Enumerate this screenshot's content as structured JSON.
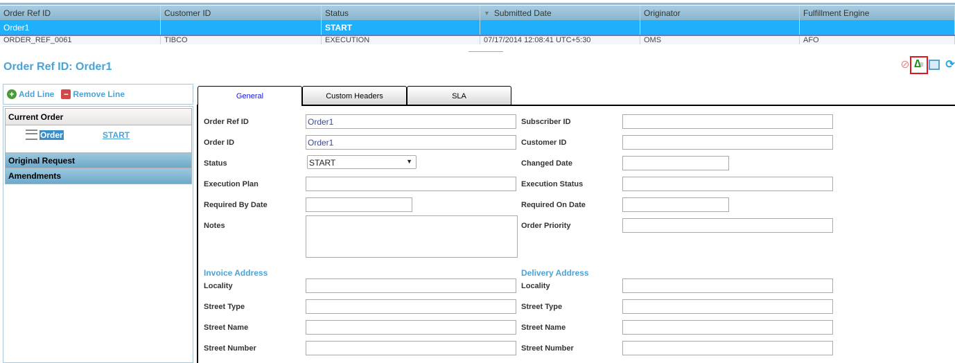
{
  "grid": {
    "columns": [
      "Order Ref ID",
      "Customer ID",
      "Status",
      "Submitted Date",
      "Originator",
      "Fulfillment Engine"
    ],
    "rows": [
      [
        "Order1",
        "",
        "START",
        "",
        "",
        ""
      ],
      [
        "ORDER_REF_0061",
        "TIBCO",
        "EXECUTION",
        "07/17/2014 12:08:41 UTC+5:30",
        "OMS",
        "AFO"
      ]
    ]
  },
  "title": "Order Ref ID: Order1",
  "toolbar": {
    "add_line": "Add Line",
    "remove_line": "Remove Line"
  },
  "tree": {
    "current_order": "Current Order",
    "node_label": "Order",
    "node_status": "START",
    "original_request": "Original Request",
    "amendments": "Amendments"
  },
  "tabs": [
    "General",
    "Custom Headers",
    "SLA"
  ],
  "form": {
    "left": [
      {
        "label": "Order Ref ID",
        "value": "Order1",
        "width": "wide"
      },
      {
        "label": "Order ID",
        "value": "Order1",
        "width": "wide"
      },
      {
        "label": "Status",
        "value": "START",
        "width": "select"
      },
      {
        "label": "Execution Plan",
        "value": "",
        "width": "wide"
      },
      {
        "label": "Required By Date",
        "value": "",
        "width": "narrow"
      },
      {
        "label": "Notes",
        "value": "",
        "width": "textarea"
      }
    ],
    "right": [
      {
        "label": "Subscriber ID",
        "value": "",
        "width": "wide"
      },
      {
        "label": "Customer ID",
        "value": "",
        "width": "wide"
      },
      {
        "label": "Changed Date",
        "value": "",
        "width": "narrow"
      },
      {
        "label": "Execution Status",
        "value": "",
        "width": "wide"
      },
      {
        "label": "Required On Date",
        "value": "",
        "width": "narrow"
      },
      {
        "label": "Order Priority",
        "value": "",
        "width": "wide"
      }
    ],
    "invoice_title": "Invoice Address",
    "delivery_title": "Delivery Address",
    "address_fields": [
      "Locality",
      "Street Type",
      "Street Name",
      "Street Number"
    ]
  }
}
